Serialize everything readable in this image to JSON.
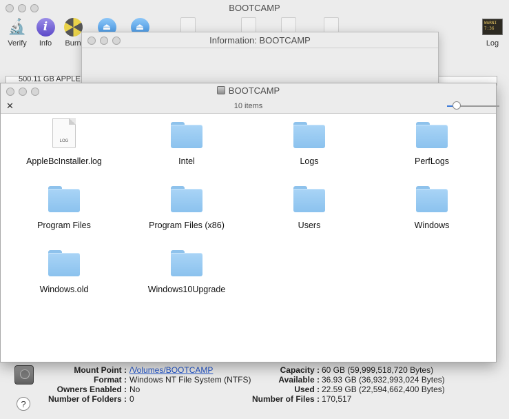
{
  "main": {
    "title": "BOOTCAMP",
    "toolbar": {
      "verify": "Verify",
      "info": "Info",
      "burn": "Burn",
      "log": "Log",
      "log_badge": "WARNI 7:36"
    },
    "disk_row": "500.11 GB APPLE"
  },
  "info_window": {
    "title": "Information: BOOTCAMP"
  },
  "finder": {
    "title": "BOOTCAMP",
    "item_count": "10 items",
    "items": [
      {
        "label": "AppleBcInstaller.log",
        "kind": "file"
      },
      {
        "label": "Intel",
        "kind": "folder"
      },
      {
        "label": "Logs",
        "kind": "folder"
      },
      {
        "label": "PerfLogs",
        "kind": "folder"
      },
      {
        "label": "Program Files",
        "kind": "folder"
      },
      {
        "label": "Program Files (x86)",
        "kind": "folder"
      },
      {
        "label": "Users",
        "kind": "folder"
      },
      {
        "label": "Windows",
        "kind": "folder"
      },
      {
        "label": "Windows.old",
        "kind": "folder"
      },
      {
        "label": "Windows10Upgrade",
        "kind": "folder"
      }
    ],
    "file_tag": "LOG",
    "icon_size_level": 0.1
  },
  "details": {
    "mount_point_label": "Mount Point :",
    "mount_point_value": "/Volumes/BOOTCAMP",
    "format_label": "Format :",
    "format_value": "Windows NT File System (NTFS)",
    "owners_label": "Owners Enabled :",
    "owners_value": "No",
    "folders_label": "Number of Folders :",
    "folders_value": "0",
    "capacity_label": "Capacity :",
    "capacity_value": "60 GB (59,999,518,720 Bytes)",
    "available_label": "Available :",
    "available_value": "36.93 GB (36,932,993,024 Bytes)",
    "used_label": "Used :",
    "used_value": "22.59 GB (22,594,662,400 Bytes)",
    "files_label": "Number of Files :",
    "files_value": "170,517",
    "help": "?"
  },
  "colors": {
    "folder": "#8bc2ee",
    "link": "#2255cc",
    "accent": "#3a78d8"
  }
}
